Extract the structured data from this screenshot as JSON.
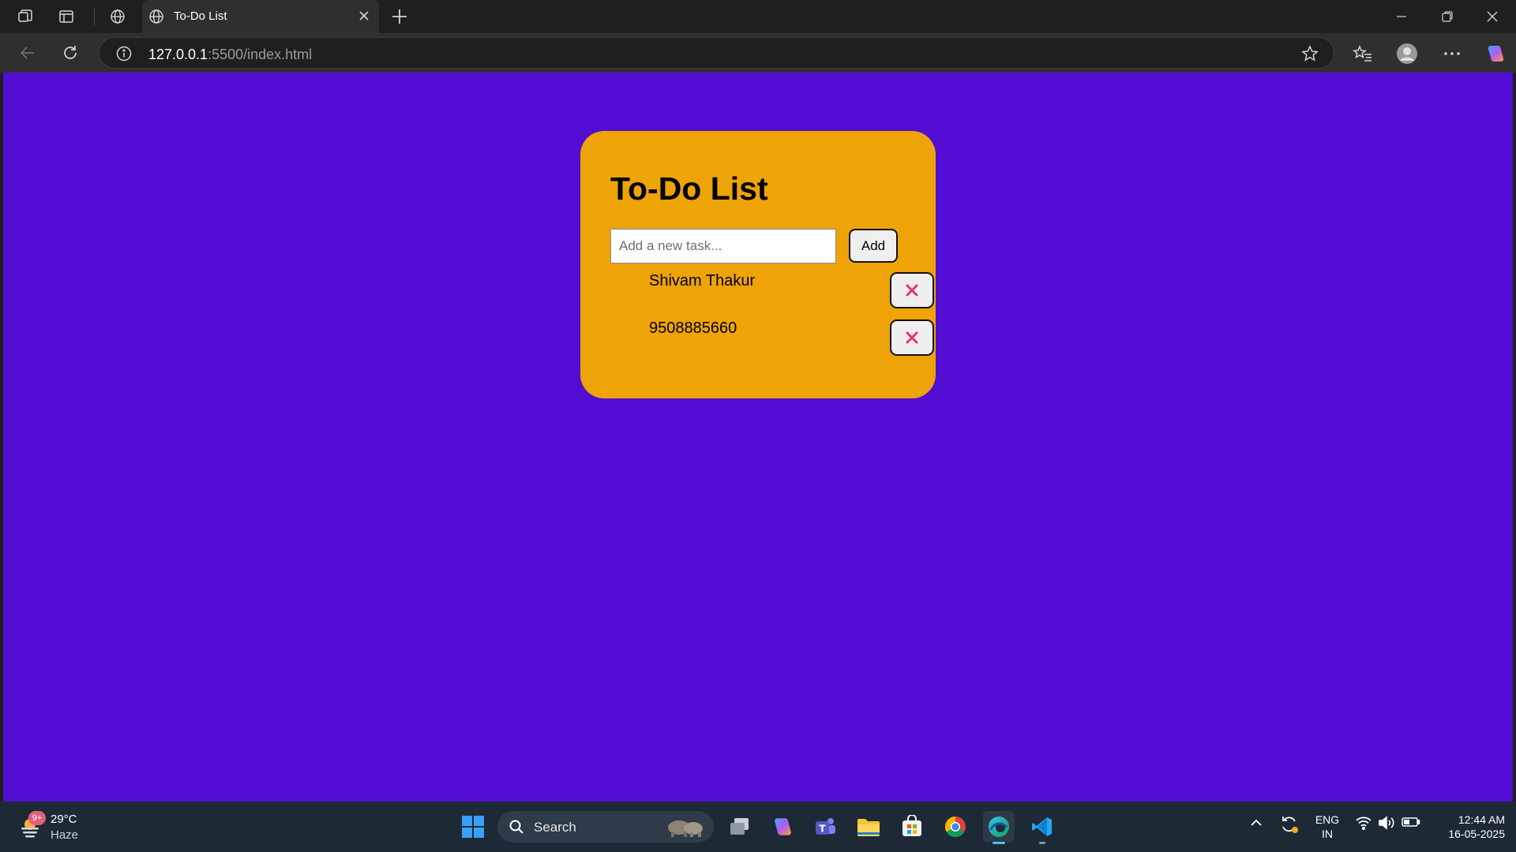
{
  "browser": {
    "tab_title": "To-Do List",
    "url_host": "127.0.0.1",
    "url_rest": ":5500/index.html"
  },
  "app": {
    "title": "To-Do List",
    "input_placeholder": "Add a new task...",
    "input_value": "",
    "add_label": "Add",
    "tasks": [
      {
        "text": "Shivam Thakur"
      },
      {
        "text": "9508885660"
      }
    ],
    "delete_icon": "close-icon",
    "colors": {
      "background": "#520dd2",
      "card": "#eea307",
      "delete": "#e5375d"
    }
  },
  "taskbar": {
    "weather_temp": "29°C",
    "weather_cond": "Haze",
    "weather_badge": "9+",
    "search_label": "Search",
    "lang_1": "ENG",
    "lang_2": "IN",
    "time": "12:44 AM",
    "date": "16-05-2025"
  }
}
